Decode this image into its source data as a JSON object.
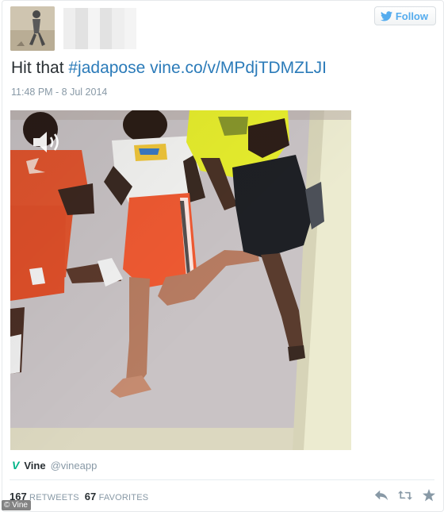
{
  "tweet": {
    "follow_label": "Follow",
    "text_plain": "Hit that ",
    "hashtag": "#jadapose",
    "link": "vine.co/v/MPdjTDMZLJI",
    "timestamp": "11:48 PM - 8 Jul 2014"
  },
  "card": {
    "vine_logo": "V",
    "vine_name": "Vine",
    "vine_handle": "@vineapp"
  },
  "stats": {
    "retweets_count": "167",
    "retweets_label": "RETWEETS",
    "favorites_count": "67",
    "favorites_label": "FAVORITES"
  },
  "actions": [
    "reply-icon",
    "retweet-icon",
    "favorite-icon"
  ],
  "colors": {
    "link": "#2b7bb9",
    "follow": "#55acee",
    "vine": "#00b488",
    "muted": "#8899a6"
  },
  "watermark": "© Vine"
}
